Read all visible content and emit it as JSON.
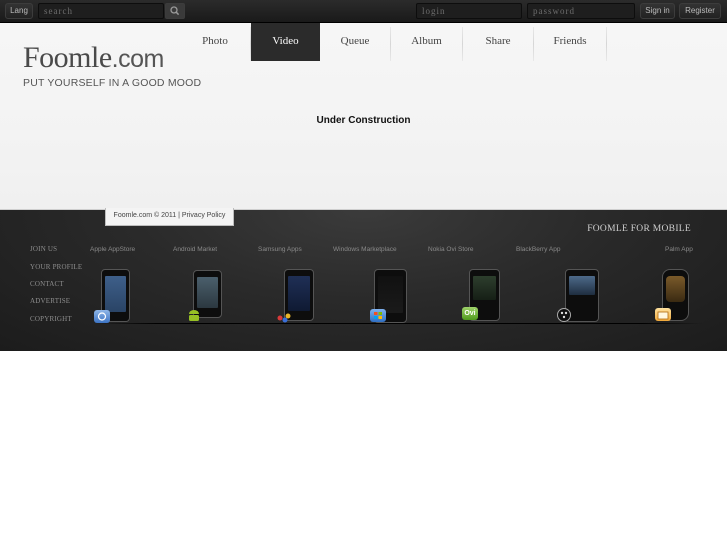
{
  "topbar": {
    "lang": "Lang",
    "search_placeholder": "search",
    "login_placeholder": "login",
    "password_placeholder": "password",
    "sign_in": "Sign in",
    "register": "Register"
  },
  "header": {
    "logo_main": "Foomle",
    "logo_domain": ".com",
    "tagline": "PUT YOURSELF IN A GOOD MOOD",
    "nav": [
      "Photo",
      "Video",
      "Queue",
      "Album",
      "Share",
      "Friends"
    ],
    "active_nav": "Video"
  },
  "main": {
    "message": "Under Construction"
  },
  "footer": {
    "copyright": "Foomle.com © 2011 | Privacy Policy",
    "mobile_title": "FOOMLE FOR MOBILE",
    "links": [
      "JOIN US",
      "YOUR PROFILE",
      "CONTACT",
      "ADVERTISE",
      "COPYRIGHT"
    ],
    "stores": [
      "Apple AppStore",
      "Android Market",
      "Samsung Apps",
      "Windows Marketplace",
      "Nokia Ovi Store",
      "BlackBerry App",
      "Palm App"
    ],
    "ovi_badge": "Ovi"
  },
  "colors": {
    "topbar": "#1f1f1f",
    "header_bg": "#f4f4f4",
    "footer_bg": "#262626",
    "nav_active": "#2b2b2b"
  }
}
